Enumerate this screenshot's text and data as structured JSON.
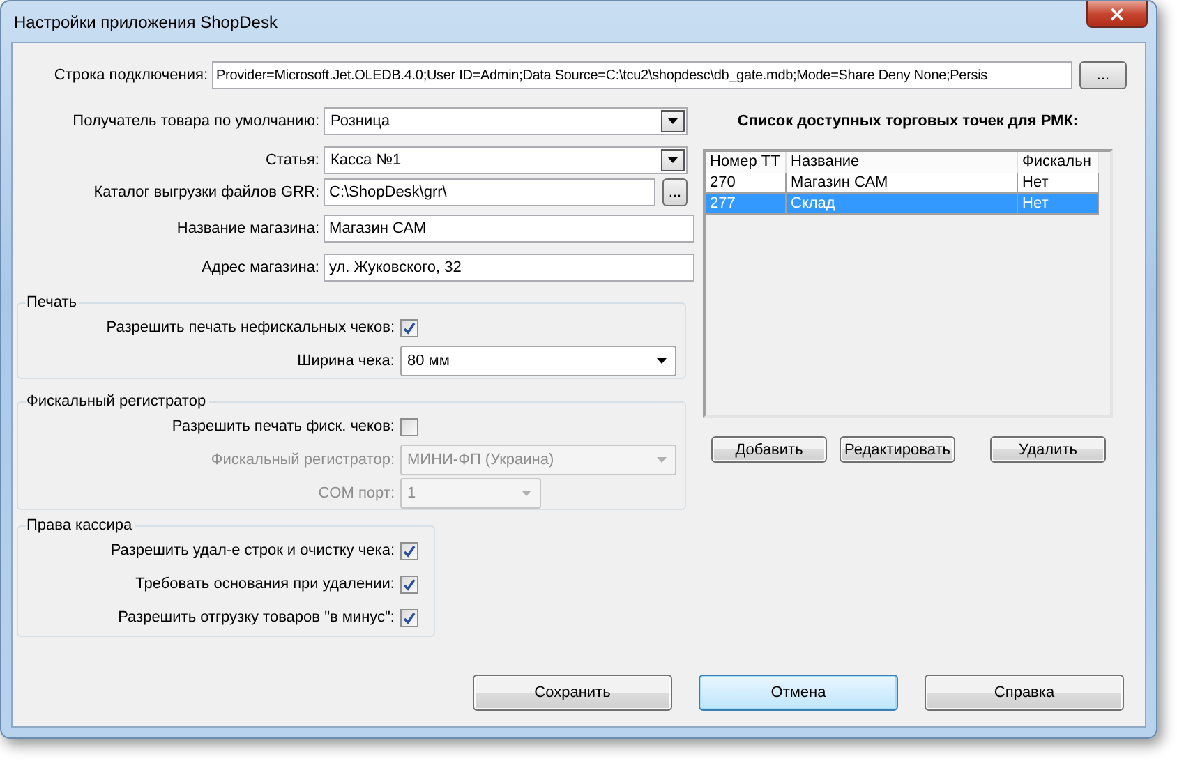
{
  "window": {
    "title": "Настройки приложения ShopDesk",
    "close": "×"
  },
  "connection": {
    "label": "Строка подключения:",
    "value": "Provider=Microsoft.Jet.OLEDB.4.0;User ID=Admin;Data Source=C:\\tcu2\\shopdesc\\db_gate.mdb;Mode=Share Deny None;Persis",
    "button": "..."
  },
  "fields": [
    {
      "kind": "combo",
      "label": "Получатель товара по умолчанию:",
      "value": "Розница"
    },
    {
      "kind": "combo",
      "label": "Статья:",
      "value": "Касса №1"
    },
    {
      "kind": "browse",
      "label": "Каталог выгрузки файлов GRR:",
      "value": "C:\\ShopDesk\\grr\\",
      "button": "..."
    },
    {
      "kind": "text",
      "label": "Название магазина:",
      "value": "Магазин САМ"
    },
    {
      "kind": "text",
      "label": "Адрес магазина:",
      "value": "ул. Жуковского, 32"
    }
  ],
  "groups": [
    {
      "title": "Печать",
      "items": [
        {
          "kind": "checkbox",
          "label": "Разрешить печать нефискальных чеков:",
          "checked": true,
          "disabled": false
        },
        {
          "kind": "dropdown",
          "label": "Ширина чека:",
          "value": "80 мм",
          "disabled": false
        }
      ]
    },
    {
      "title": "Фискальный регистратор",
      "items": [
        {
          "kind": "checkbox",
          "label": "Разрешить печать фиск. чеков:",
          "checked": false,
          "disabled": false
        },
        {
          "kind": "dropdown",
          "label": "Фискальный регистратор:",
          "value": "МИНИ-ФП (Украина)",
          "disabled": true
        },
        {
          "kind": "smalldropdown",
          "label": "COM порт:",
          "value": "1",
          "disabled": true
        }
      ]
    },
    {
      "title": "Права кассира",
      "items": [
        {
          "kind": "checkbox",
          "label": "Разрешить удал-е строк и очистку чека:",
          "checked": true,
          "disabled": false
        },
        {
          "kind": "checkbox",
          "label": "Требовать основания при удалении:",
          "checked": true,
          "disabled": false
        },
        {
          "kind": "checkbox",
          "label": "Разрешить отгрузку товаров \"в минус\":",
          "checked": true,
          "disabled": false
        }
      ]
    }
  ],
  "outlets": {
    "title": "Список доступных торговых точек для РМК:",
    "columns": [
      "Номер ТТ",
      "Название",
      "Фискальн"
    ],
    "rows": [
      {
        "cells": [
          "270",
          "Магазин САМ",
          "Нет"
        ],
        "selected": false
      },
      {
        "cells": [
          "277",
          "Склад",
          "Нет"
        ],
        "selected": true
      }
    ],
    "buttons": [
      "Добавить",
      "Редактировать",
      "Удалить"
    ]
  },
  "buttons": [
    {
      "label": "Сохранить",
      "focused": false
    },
    {
      "label": "Отмена",
      "focused": true
    },
    {
      "label": "Справка",
      "focused": false
    }
  ]
}
